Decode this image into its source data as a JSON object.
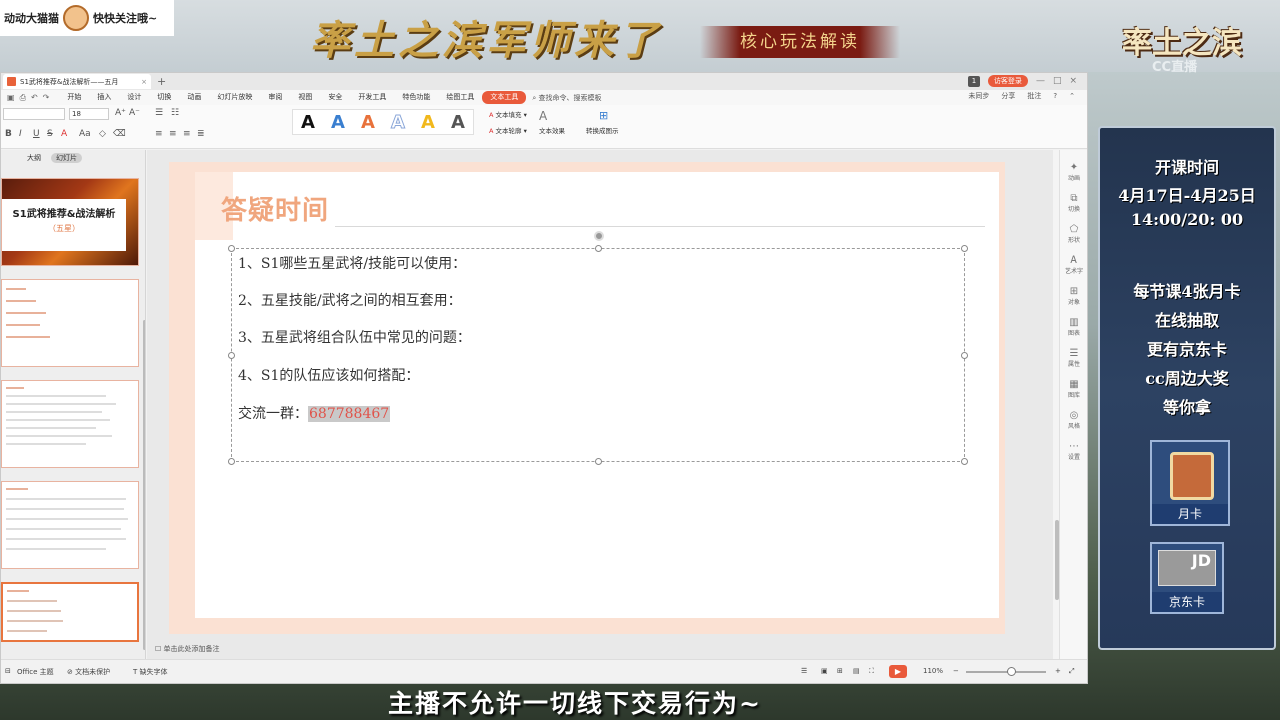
{
  "overlay": {
    "badge_left": "动动大猫猫",
    "badge_right": "快快关注哦~",
    "game_title": "率土之滨军师来了",
    "core_banner": "核心玩法解读",
    "logo_right": "率土之滨",
    "cc_mark": "CC直播",
    "panel": {
      "l1": "开课时间",
      "l2": "4月17日-4月25日",
      "l3": "14:00/20: 00",
      "l4": "每节课4张月卡",
      "l5": "在线抽取",
      "l6": "更有京东卡",
      "l7": "cc周边大奖",
      "l8": "等你拿",
      "card1": "月卡",
      "card2": "京东卡"
    },
    "caption": "主播不允许一切线下交易行为~"
  },
  "titlebar": {
    "doc_tab": "S1武将推荐&战法解析——五月",
    "page_badge": "1",
    "login": "访客登录"
  },
  "menu": {
    "items": [
      "开始",
      "插入",
      "设计",
      "切换",
      "动画",
      "幻灯片放映",
      "审阅",
      "视图",
      "安全",
      "开发工具",
      "特色功能",
      "绘图工具",
      "文本工具"
    ],
    "active_index": 12,
    "search": "查找命令、搜索模板",
    "right": [
      "未同步",
      "分享",
      "批注"
    ]
  },
  "ribbon": {
    "font_size": "18",
    "fill_label": "文本填充",
    "outline_label": "文本轮廓",
    "effect_label": "文本效果",
    "convert_label": "转换成图示",
    "style_colors": [
      "#111111",
      "#3a7fd0",
      "#e8723b",
      "#8aa6d8",
      "#f1b81c",
      "#555555"
    ]
  },
  "sidebar": {
    "tab_outline": "大纲",
    "tab_slides": "幻灯片",
    "thumb1_title": "S1武将推荐&战法解析",
    "thumb1_sub": "（五星）"
  },
  "slide": {
    "title": "答疑时间",
    "q1": "1、S1哪些五星武将/技能可以使用：",
    "q2": "2、五星技能/武将之间的相互套用：",
    "q3": "3、五星武将组合队伍中常见的问题：",
    "q4": "4、S1的队伍应该如何搭配：",
    "group_label": "交流一群：",
    "group_number": "687788467"
  },
  "notes": "单击此处添加备注",
  "tools": [
    "动画",
    "切换",
    "形状",
    "艺术字",
    "对象",
    "图表",
    "属性",
    "图库",
    "风格",
    "设置"
  ],
  "status": {
    "theme": "Office 主题",
    "protect": "文档未保护",
    "font_missing": "缺失字体",
    "zoom": "110%"
  }
}
